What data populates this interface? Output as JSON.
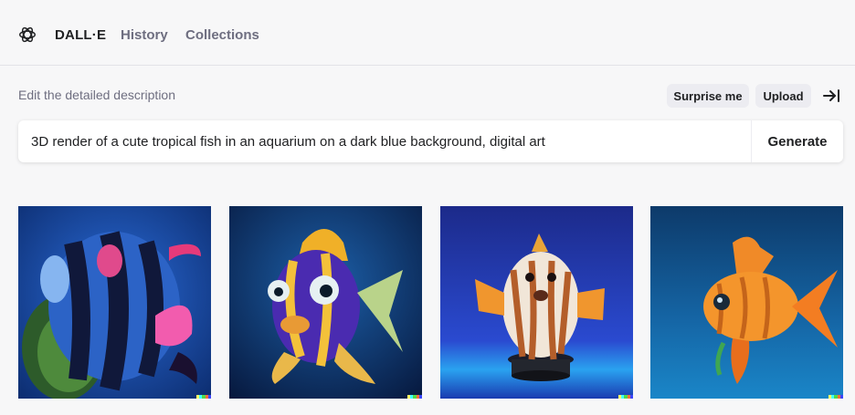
{
  "app": {
    "brand": "DALL·E",
    "nav": [
      {
        "label": "History"
      },
      {
        "label": "Collections"
      }
    ]
  },
  "prompt": {
    "label": "Edit the detailed description",
    "value": "3D render of a cute tropical fish in an aquarium on a dark blue background, digital art",
    "generate_label": "Generate"
  },
  "actions": {
    "surprise_label": "Surprise me",
    "upload_label": "Upload"
  },
  "icons": {
    "logo": "openai-logo-icon",
    "collapse": "arrow-right-to-bar-icon"
  },
  "results": [
    {
      "name": "striped-tropical-fish-image"
    },
    {
      "name": "yellow-purple-cartoon-fish-image"
    },
    {
      "name": "orange-white-fish-on-pedestal-image"
    },
    {
      "name": "orange-goldfish-image"
    }
  ],
  "watermark_colors": [
    "#ffff66",
    "#42ffff",
    "#51da4c",
    "#ff6e3c",
    "#3c46ff"
  ]
}
